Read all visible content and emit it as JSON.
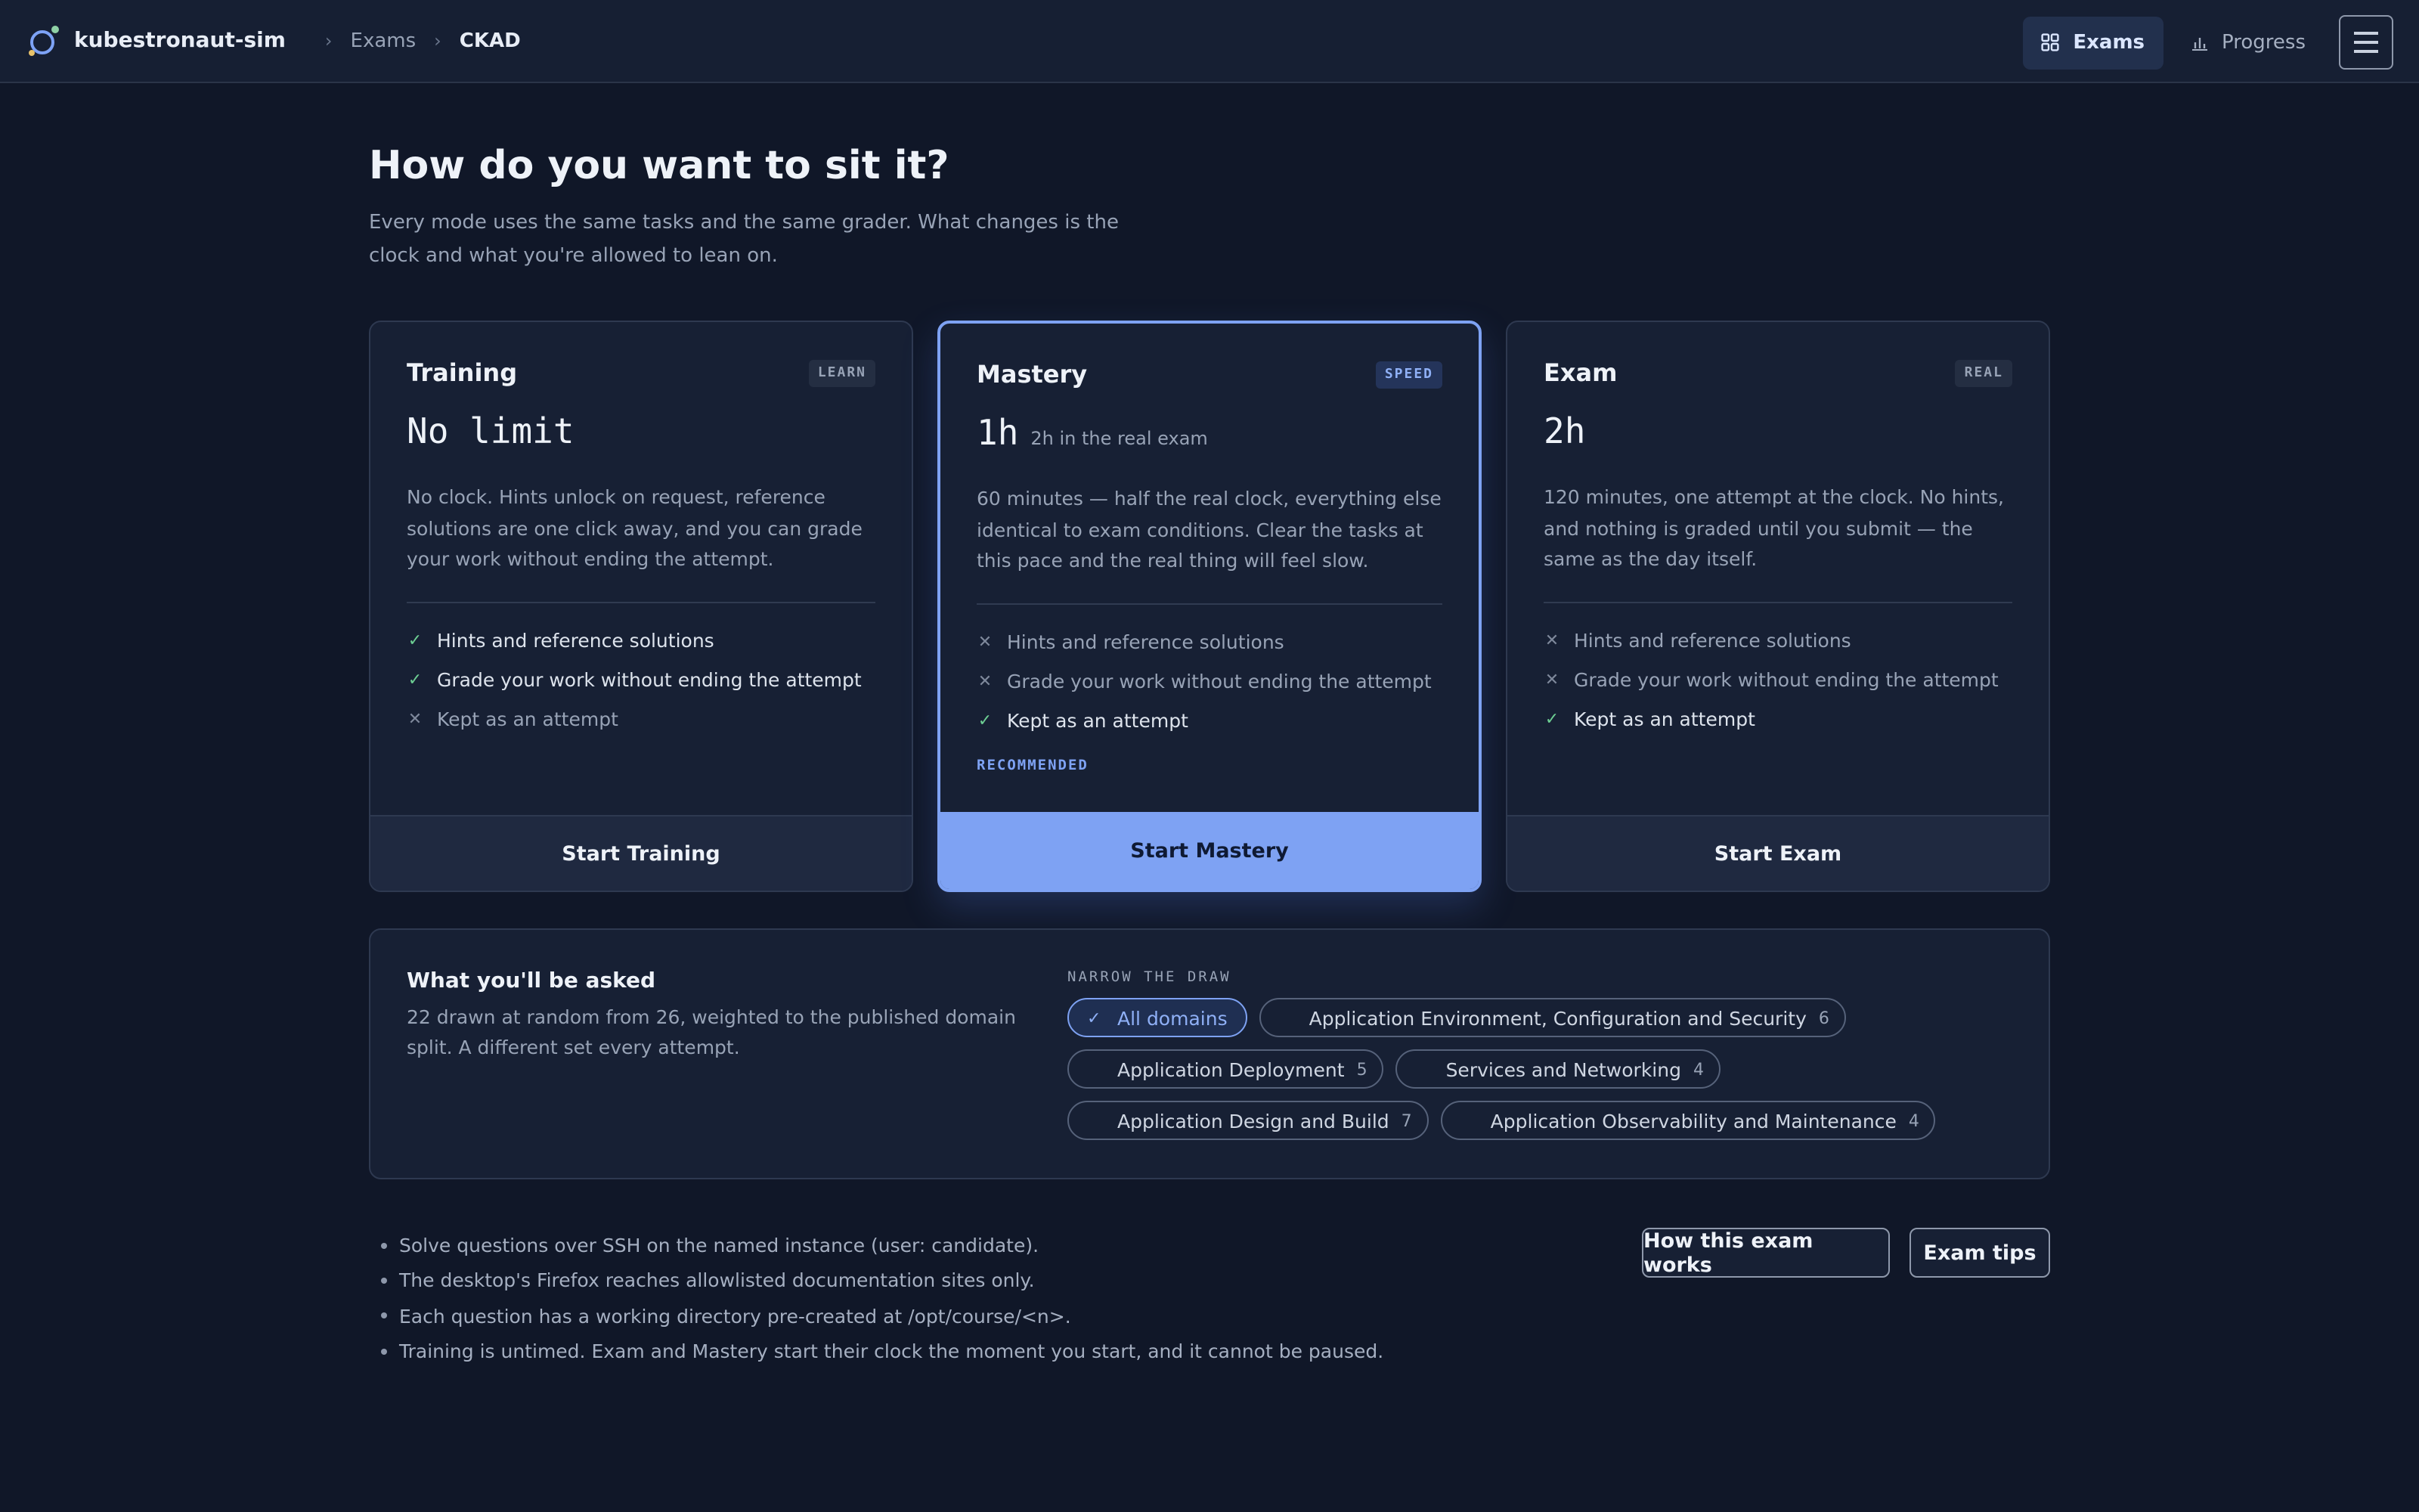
{
  "app": {
    "name": "kubestronaut-sim"
  },
  "breadcrumb": [
    "Exams",
    "CKAD"
  ],
  "nav": {
    "exams_label": "Exams",
    "progress_label": "Progress"
  },
  "hero": {
    "title": "How do you want to sit it?",
    "subtitle": "Every mode uses the same tasks and the same grader. What changes is the clock and what you're allowed to lean on."
  },
  "modes": [
    {
      "title": "Training",
      "tag": "LEARN",
      "duration": "No limit",
      "duration_note": "",
      "description": "No clock. Hints unlock on request, reference solutions are one click away, and you can grade your work without ending the attempt.",
      "features": [
        {
          "text": "Hints and reference solutions",
          "enabled": true
        },
        {
          "text": "Grade your work without ending the attempt",
          "enabled": true
        },
        {
          "text": "Kept as an attempt",
          "enabled": false
        }
      ],
      "recommended": "",
      "button": "Start Training"
    },
    {
      "title": "Mastery",
      "tag": "SPEED",
      "duration": "1h",
      "duration_note": "2h in the real exam",
      "description": "60 minutes — half the real clock, everything else identical to exam conditions. Clear the tasks at this pace and the real thing will feel slow.",
      "features": [
        {
          "text": "Hints and reference solutions",
          "enabled": false
        },
        {
          "text": "Grade your work without ending the attempt",
          "enabled": false
        },
        {
          "text": "Kept as an attempt",
          "enabled": true
        }
      ],
      "recommended": "RECOMMENDED",
      "button": "Start Mastery"
    },
    {
      "title": "Exam",
      "tag": "REAL",
      "duration": "2h",
      "duration_note": "",
      "description": "120 minutes, one attempt at the clock. No hints, and nothing is graded until you submit — the same as the day itself.",
      "features": [
        {
          "text": "Hints and reference solutions",
          "enabled": false
        },
        {
          "text": "Grade your work without ending the attempt",
          "enabled": false
        },
        {
          "text": "Kept as an attempt",
          "enabled": true
        }
      ],
      "recommended": "",
      "button": "Start Exam"
    }
  ],
  "domains": {
    "title": "What you'll be asked",
    "description": "22 drawn at random from 26, weighted to the published domain split. A different set every attempt.",
    "narrow_label": "NARROW THE DRAW",
    "all_label": "All domains",
    "chips": [
      {
        "label": "Application Environment, Configuration and Security",
        "count": "6"
      },
      {
        "label": "Application Deployment",
        "count": "5"
      },
      {
        "label": "Services and Networking",
        "count": "4"
      },
      {
        "label": "Application Design and Build",
        "count": "7"
      },
      {
        "label": "Application Observability and Maintenance",
        "count": "4"
      }
    ]
  },
  "notes": [
    "Solve questions over SSH on the named instance (user: candidate).",
    "The desktop's Firefox reaches allowlisted documentation sites only.",
    "Each question has a working directory pre-created at /opt/course/<n>.",
    "Training is untimed. Exam and Mastery start their clock the moment you start, and it cannot be paused."
  ],
  "footer": {
    "how_label": "How this exam works",
    "tips_label": "Exam tips"
  },
  "colors": {
    "background": "#101728",
    "accent": "#7ea2f3",
    "check": "#6dcf93"
  }
}
